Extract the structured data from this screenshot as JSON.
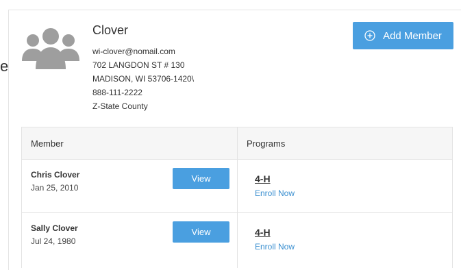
{
  "left_fragment": "e",
  "family": {
    "name": "Clover",
    "email": "wi-clover@nomail.com",
    "address_line1": "702 LANGDON ST # 130",
    "address_line2": "MADISON, WI 53706-1420\\",
    "phone": "888-111-2222",
    "county": "Z-State County"
  },
  "add_member_label": "Add Member",
  "table": {
    "headers": {
      "member": "Member",
      "programs": "Programs"
    },
    "rows": [
      {
        "name": "Chris Clover",
        "dob": "Jan 25, 2010",
        "view_label": "View",
        "program": "4-H",
        "enroll_label": "Enroll Now"
      },
      {
        "name": "Sally Clover",
        "dob": "Jul 24, 1980",
        "view_label": "View",
        "program": "4-H",
        "enroll_label": "Enroll Now"
      }
    ]
  },
  "colors": {
    "accent": "#4a9fe0",
    "link": "#3a8fd0",
    "avatar": "#9e9e9e"
  },
  "icons": {
    "avatar": "family-group-icon",
    "add": "plus-circle-icon"
  }
}
